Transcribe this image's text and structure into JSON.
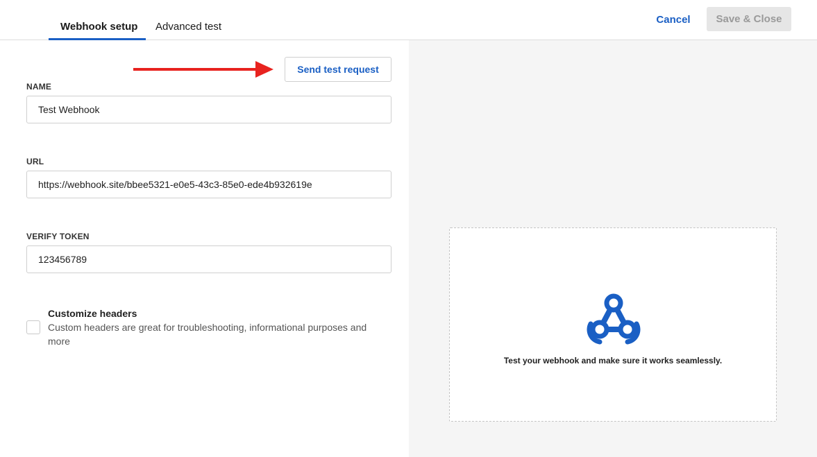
{
  "header": {
    "tabs": [
      {
        "label": "Webhook setup",
        "active": true
      },
      {
        "label": "Advanced test",
        "active": false
      }
    ],
    "cancel_label": "Cancel",
    "save_label": "Save & Close"
  },
  "form": {
    "send_test_label": "Send test request",
    "name": {
      "label": "NAME",
      "value": "Test Webhook"
    },
    "url": {
      "label": "URL",
      "value": "https://webhook.site/bbee5321-e0e5-43c3-85e0-ede4b932619e"
    },
    "verify_token": {
      "label": "VERIFY TOKEN",
      "value": "123456789"
    },
    "custom_headers": {
      "title": "Customize headers",
      "description": "Custom headers are great for troubleshooting, informational purposes and more",
      "checked": false
    }
  },
  "panel": {
    "icon": "webhook-icon",
    "message": "Test your webhook and make sure it works seamlessly."
  },
  "colors": {
    "accent": "#1a5fc4",
    "arrow": "#e8231f",
    "panel_bg": "#f5f5f5"
  }
}
